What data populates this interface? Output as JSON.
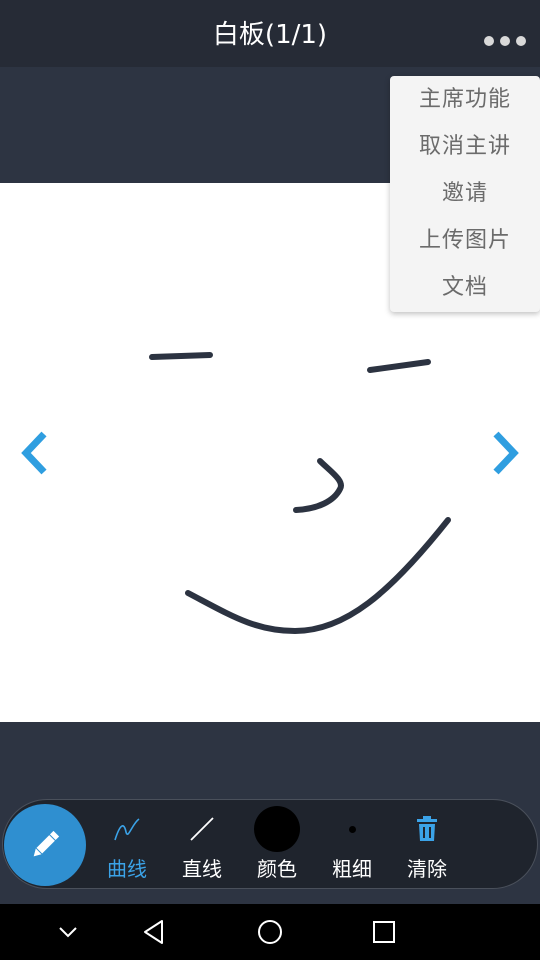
{
  "header": {
    "title": "白板(1/1)",
    "more_icon": "more-horizontal-icon"
  },
  "menu": {
    "items": [
      {
        "label": "主席功能"
      },
      {
        "label": "取消主讲"
      },
      {
        "label": "邀请"
      },
      {
        "label": "上传图片"
      },
      {
        "label": "文档"
      }
    ]
  },
  "navigation": {
    "prev_icon": "chevron-left-icon",
    "next_icon": "chevron-right-icon"
  },
  "toolbar": {
    "pen_icon": "pencil-icon",
    "tools": [
      {
        "label": "曲线",
        "icon": "curve-icon",
        "active": true
      },
      {
        "label": "直线",
        "icon": "line-icon",
        "active": false
      },
      {
        "label": "颜色",
        "icon": "color-swatch-icon",
        "active": false,
        "value": "#000000"
      },
      {
        "label": "粗细",
        "icon": "thickness-dot-icon",
        "active": false
      },
      {
        "label": "清除",
        "icon": "trash-icon",
        "active": false
      }
    ]
  },
  "system_nav": {
    "icons": [
      "chevron-down-icon",
      "back-triangle-icon",
      "home-circle-icon",
      "recents-square-icon"
    ]
  },
  "colors": {
    "accent": "#2f8fd0",
    "active_label": "#3ba3e8",
    "header_bg": "#262b36",
    "stroke": "#2c3341"
  }
}
